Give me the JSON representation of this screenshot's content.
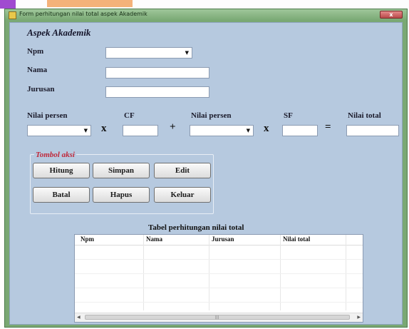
{
  "window": {
    "title": "Form perhitungan nilai total aspek Akademik",
    "close_glyph": "x"
  },
  "form": {
    "section_title": "Aspek Akademik",
    "npm_label": "Npm",
    "nama_label": "Nama",
    "jurusan_label": "Jurusan",
    "nilai_persen_label_1": "Nilai persen",
    "cf_label": "CF",
    "nilai_persen_label_2": "Nilai persen",
    "sf_label": "SF",
    "nilai_total_label": "Nilai total",
    "op_times_1": "x",
    "op_plus": "+",
    "op_times_2": "x",
    "op_equals": "=",
    "npm_value": "",
    "nama_value": "",
    "jurusan_value": "",
    "nilai_persen_1_value": "",
    "cf_value": "",
    "nilai_persen_2_value": "",
    "sf_value": "",
    "nilai_total_value": ""
  },
  "actions": {
    "group_title": "Tombol aksi",
    "hitung": "Hitung",
    "simpan": "Simpan",
    "edit": "Edit",
    "batal": "Batal",
    "hapus": "Hapus",
    "keluar": "Keluar"
  },
  "table": {
    "title": "Tabel perhitungan nilai total",
    "columns": [
      "Npm",
      "Nama",
      "Jurusan",
      "Nilai total"
    ],
    "rows": []
  },
  "icons": {
    "dropdown": "chevron-down-icon",
    "scroll_left": "scroll-left-icon",
    "scroll_right": "scroll-right-icon"
  }
}
